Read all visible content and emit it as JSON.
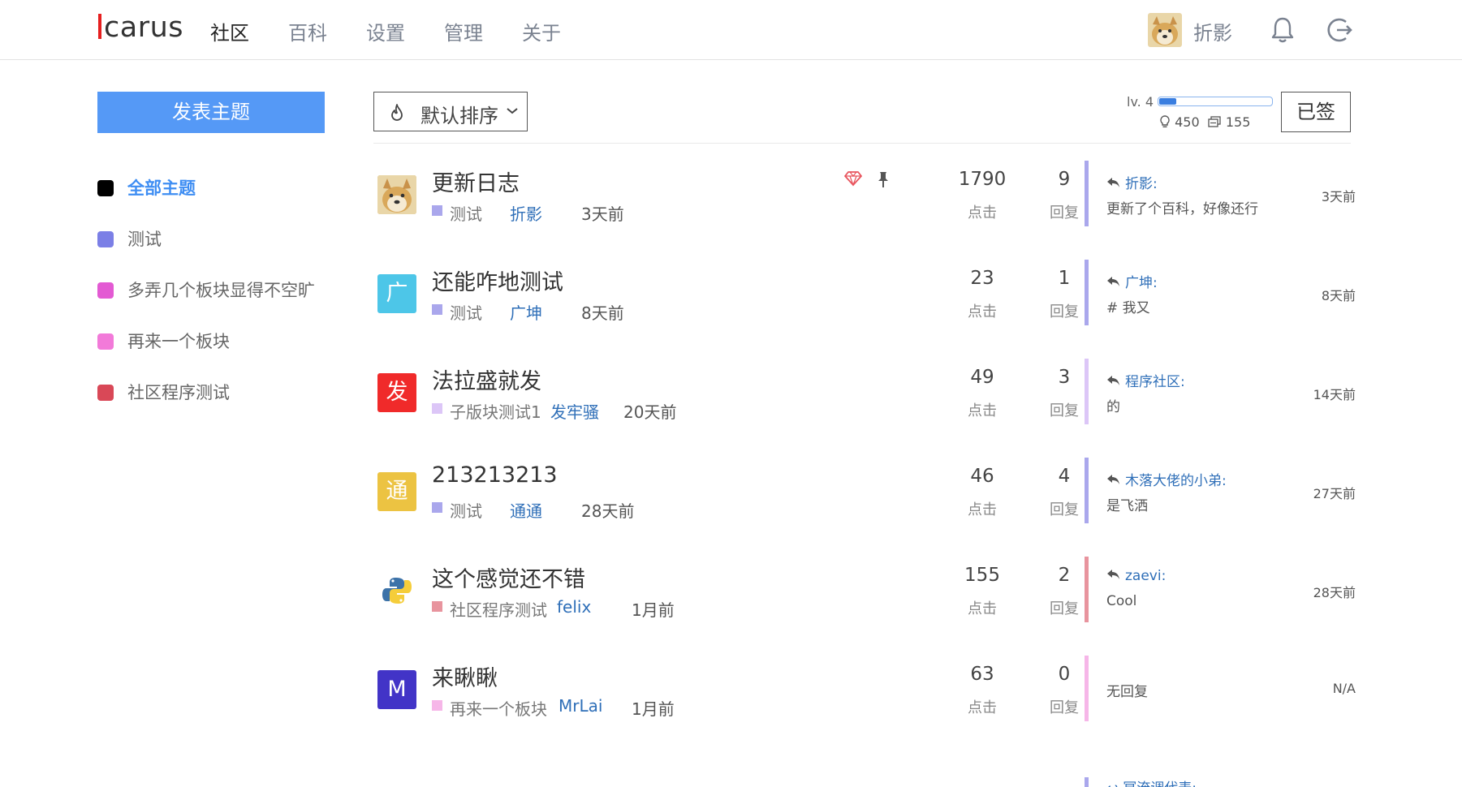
{
  "header": {
    "logo_rest": "carus",
    "nav": [
      "社区",
      "百科",
      "设置",
      "管理",
      "关于"
    ],
    "user_name": "折影"
  },
  "sidebar": {
    "post_button": "发表主题",
    "categories": [
      {
        "label": "全部主题",
        "color": "#000000"
      },
      {
        "label": "测试",
        "color": "#7b7fe6"
      },
      {
        "label": "多弄几个板块显得不空旷",
        "color": "#e35ad3"
      },
      {
        "label": "再来一个板块",
        "color": "#f27ad9"
      },
      {
        "label": "社区程序测试",
        "color": "#d94857"
      }
    ]
  },
  "toolbar": {
    "sort_label": "默认排序",
    "level": "lv. 4",
    "level_progress": 0.15,
    "exp": "450",
    "coins": "155",
    "signed_label": "已签"
  },
  "labels": {
    "clicks": "点击",
    "replies": "回复",
    "no_reply": "无回复"
  },
  "topics": [
    {
      "title": "更新日志",
      "avatar_text": "",
      "avatar_color": "#d8b474",
      "board": "测试",
      "board_color": "#aaa7ec",
      "author": "折影",
      "time": "3天前",
      "views": "1790",
      "replies": "9",
      "reply_user": "折影:",
      "reply_text": "更新了个百科，好像还行",
      "reply_time": "3天前",
      "bar_color": "#aaa7ec"
    },
    {
      "title": "还能咋地测试",
      "avatar_text": "广",
      "avatar_color": "#4dc6e8",
      "board": "测试",
      "board_color": "#aaa7ec",
      "author": "广坤",
      "time": "8天前",
      "views": "23",
      "replies": "1",
      "reply_user": "广坤:",
      "reply_text": "# 我又",
      "reply_time": "8天前",
      "bar_color": "#aaa7ec"
    },
    {
      "title": "法拉盛就发",
      "avatar_text": "发",
      "avatar_color": "#f02a2a",
      "board": "子版块测试1",
      "board_color": "#dcc6f7",
      "author": "发牢骚",
      "time": "20天前",
      "views": "49",
      "replies": "3",
      "reply_user": "程序社区:",
      "reply_text": "的",
      "reply_time": "14天前",
      "bar_color": "#dcc6f7"
    },
    {
      "title": "213213213",
      "avatar_text": "通",
      "avatar_color": "#ecc342",
      "board": "测试",
      "board_color": "#aaa7ec",
      "author": "通通",
      "time": "28天前",
      "views": "46",
      "replies": "4",
      "reply_user": "木落大佬的小弟:",
      "reply_text": "是飞洒",
      "reply_time": "27天前",
      "bar_color": "#aaa7ec"
    },
    {
      "title": "这个感觉还不错",
      "avatar_text": "",
      "avatar_color": "#ffffff",
      "board": "社区程序测试",
      "board_color": "#e8949e",
      "author": "felix",
      "time": "1月前",
      "views": "155",
      "replies": "2",
      "reply_user": "zaevi:",
      "reply_text": "Cool",
      "reply_time": "28天前",
      "bar_color": "#e8949e"
    },
    {
      "title": "来瞅瞅",
      "avatar_text": "M",
      "avatar_color": "#4234c7",
      "board": "再来一个板块",
      "board_color": "#f6b6e8",
      "author": "MrLai",
      "time": "1月前",
      "views": "63",
      "replies": "0",
      "reply_user": "",
      "reply_text": "",
      "reply_time": "N/A",
      "bar_color": "#f6b6e8"
    }
  ],
  "partial_next": {
    "reply_user": "冥淹调代表:"
  }
}
